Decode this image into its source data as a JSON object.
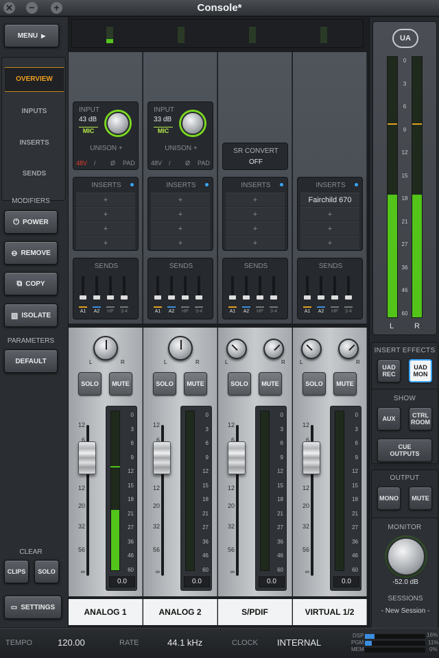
{
  "window": {
    "title": "Console*"
  },
  "sidebar": {
    "menu": "MENU",
    "nav": [
      "OVERVIEW",
      "INPUTS",
      "INSERTS",
      "SENDS"
    ],
    "modifiers_title": "MODIFIERS",
    "modifiers": [
      "POWER",
      "REMOVE",
      "COPY",
      "ISOLATE"
    ],
    "parameters_title": "PARAMETERS",
    "default": "DEFAULT",
    "clear_title": "CLEAR",
    "clips": "CLIPS",
    "solo": "SOLO",
    "settings": "SETTINGS"
  },
  "channels": [
    {
      "name": "ANALOG 1",
      "input_label": "INPUT",
      "gain": "43 dB",
      "mic": "MIC",
      "unison": "UNISON +",
      "flags": [
        "48V",
        "/",
        "Ø",
        "PAD"
      ],
      "inserts_label": "INSERTS",
      "inserts": [
        "+",
        "+",
        "+",
        "+"
      ],
      "sends_label": "SENDS",
      "send_labels": [
        "A1",
        "A2",
        "HP",
        "3-4"
      ],
      "solo": "SOLO",
      "mute": "MUTE",
      "fader_value": "0.0",
      "meter_level": 0.38
    },
    {
      "name": "ANALOG 2",
      "input_label": "INPUT",
      "gain": "33 dB",
      "mic": "MIC",
      "unison": "UNISON +",
      "flags": [
        "48V",
        "/",
        "Ø",
        "PAD"
      ],
      "inserts_label": "INSERTS",
      "inserts": [
        "+",
        "+",
        "+",
        "+"
      ],
      "sends_label": "SENDS",
      "send_labels": [
        "A1",
        "A2",
        "HP",
        "3-4"
      ],
      "solo": "SOLO",
      "mute": "MUTE",
      "fader_value": "0.0",
      "meter_level": 0
    },
    {
      "name": "S/PDIF",
      "sr_label": "SR CONVERT",
      "sr_value": "OFF",
      "inserts_label": "INSERTS",
      "inserts": [
        "+",
        "+",
        "+",
        "+"
      ],
      "sends_label": "SENDS",
      "send_labels": [
        "A1",
        "A2",
        "HP",
        "3-4"
      ],
      "solo": "SOLO",
      "mute": "MUTE",
      "fader_value": "0.0",
      "meter_level": 0
    },
    {
      "name": "VIRTUAL 1/2",
      "inserts_label": "INSERTS",
      "inserts": [
        "Fairchild 670",
        "+",
        "+",
        "+"
      ],
      "sends_label": "SENDS",
      "send_labels": [
        "A1",
        "A2",
        "HP",
        "3-4"
      ],
      "solo": "SOLO",
      "mute": "MUTE",
      "fader_value": "0.0",
      "meter_level": 0
    }
  ],
  "fader_scale": [
    "12",
    "6",
    "0",
    "6",
    "12",
    "20",
    "32",
    "56",
    "∞"
  ],
  "meter_scale": [
    "0",
    "3",
    "6",
    "9",
    "12",
    "15",
    "18",
    "21",
    "27",
    "36",
    "46",
    "60"
  ],
  "master": {
    "logo": "UA",
    "meter_scale": [
      "0",
      "3",
      "6",
      "9",
      "12",
      "15",
      "18",
      "21",
      "27",
      "36",
      "46",
      "60"
    ],
    "left_label": "L",
    "right_label": "R",
    "level_left": 0.47,
    "level_right": 0.47,
    "insert_effects": "INSERT EFFECTS",
    "uad_rec": "UAD REC",
    "uad_mon": "UAD MON",
    "show": "SHOW",
    "aux": "AUX",
    "ctrl_room": "CTRL ROOM",
    "cue_outputs": "CUE OUTPUTS",
    "output": "OUTPUT",
    "mono": "MONO",
    "mute": "MUTE",
    "monitor": "MONITOR",
    "monitor_value": "-52.0 dB",
    "sessions": "SESSIONS",
    "session_name": "- New Session -"
  },
  "statusbar": {
    "tempo_label": "TEMPO",
    "tempo": "120.00",
    "rate_label": "RATE",
    "rate": "44.1 kHz",
    "clock_label": "CLOCK",
    "clock": "INTERNAL",
    "dsp_label": "DSP",
    "dsp": "16%",
    "pgm_label": "PGM",
    "pgm": "11%",
    "mem_label": "MEM",
    "mem": "0%"
  },
  "colors": {
    "accent": "#f0a020",
    "meter_green": "#52c41a",
    "uad_blue": "#3aa7ff"
  }
}
